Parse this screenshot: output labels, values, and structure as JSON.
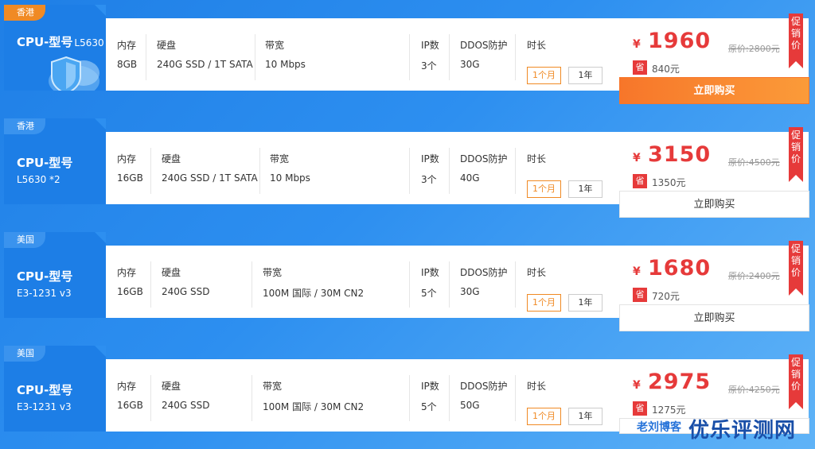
{
  "labels": {
    "memory": "内存",
    "disk": "硬盘",
    "bandwidth": "带宽",
    "ip": "IP数",
    "ddos": "DDOS防护",
    "duration": "时长",
    "dur_month": "1个月",
    "dur_year": "1年",
    "yen": "¥",
    "save": "省",
    "promo": "促销价",
    "buy": "立即购买",
    "cpu_title": "CPU-型号"
  },
  "colors": {
    "card_left": "#1d7ee6",
    "region_orange": "#f08a24",
    "price_red": "#e63a3a",
    "buy_orange": "#f7762a"
  },
  "cards": [
    {
      "region": "香港",
      "cpu_model": "L5630",
      "memory": "8GB",
      "disk": "240G SSD / 1T SATA",
      "bandwidth": "10 Mbps",
      "ip": "3个",
      "ddos": "30G",
      "price": "1960",
      "original": "原价:2800元",
      "saving": "840元"
    },
    {
      "region": "香港",
      "cpu_model": "L5630 *2",
      "memory": "16GB",
      "disk": "240G SSD / 1T SATA",
      "bandwidth": "10 Mbps",
      "ip": "3个",
      "ddos": "40G",
      "price": "3150",
      "original": "原价:4500元",
      "saving": "1350元"
    },
    {
      "region": "美国",
      "cpu_model": "E3-1231 v3",
      "memory": "16GB",
      "disk": "240G SSD",
      "bandwidth": "100M 国际 / 30M CN2",
      "ip": "5个",
      "ddos": "30G",
      "price": "1680",
      "original": "原价:2400元",
      "saving": "720元"
    },
    {
      "region": "美国",
      "cpu_model": "E3-1231 v3",
      "memory": "16GB",
      "disk": "240G SSD",
      "bandwidth": "100M 国际 / 30M CN2",
      "ip": "5个",
      "ddos": "50G",
      "price": "2975",
      "original": "原价:4250元",
      "saving": "1275元"
    }
  ],
  "watermark": {
    "blog": "老刘博客",
    "site": "优乐评测网"
  }
}
